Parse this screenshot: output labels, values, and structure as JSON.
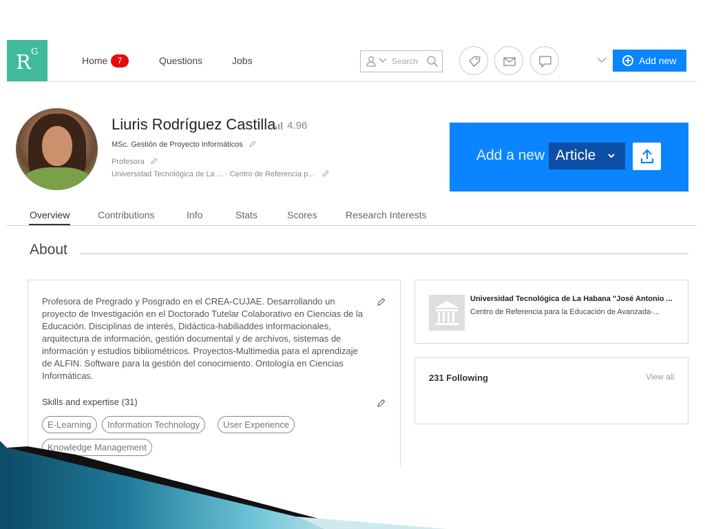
{
  "header": {
    "logo": {
      "main": "R",
      "sup": "G"
    },
    "nav": [
      {
        "label": "Home",
        "badge": "7"
      },
      {
        "label": "Questions"
      },
      {
        "label": "Jobs"
      }
    ],
    "search": {
      "placeholder": "Search"
    },
    "icons": [
      "person-icon",
      "chevron-down-icon",
      "search-icon",
      "tag-icon",
      "mail-icon",
      "chat-icon"
    ],
    "add_new_label": "Add new"
  },
  "profile": {
    "name": "Liuris Rodríguez Castilla",
    "rg_score": "4.96",
    "degree": "MSc. Gestión de Proyecto Informáticos",
    "position": "Profesora",
    "institution": "Universidad Tecnológica de La ... · Centro de Referencia p..."
  },
  "promo": {
    "prefix": "Add a new",
    "selected": "Article"
  },
  "tabs": [
    "Overview",
    "Contributions",
    "Info",
    "Stats",
    "Scores",
    "Research Interests"
  ],
  "active_tab": "Overview",
  "about": {
    "title": "About",
    "bio": "Profesora de Pregrado y Posgrado en el CREA-CUJAE. Desarrollando un proyecto de Investigación en el Doctorado Tutelar Colaborativo en Ciencias de la Educación. Disciplinas de interés, Didáctica-habiliaddes informacionales, arquitectura de información, gestión documental y de archivos, sistemas de información y estudios bibliométricos. Proyectos-Multimedia para el aprendizaje de ALFIN. Software para la gestión del conocimiento. Ontología en Ciencias Informáticas.",
    "skills_title": "Skills and expertise (31)",
    "skills": [
      "E-Learning",
      "Information Technology",
      "User Experience",
      "Knowledge Management"
    ]
  },
  "institution_card": {
    "name": "Universidad Tecnológica de La Habana \"José Antonio ...",
    "department": "Centro de Referencia para la Educación de Avanzada-..."
  },
  "following": {
    "title": "231 Following",
    "view_all": "View all"
  },
  "colors": {
    "logo": "#40ba9b",
    "primary": "#0a84ff",
    "primary_dark": "#0b4fa6",
    "badge": "#e40d0d",
    "slide_decoration": "#1f6f8b"
  }
}
